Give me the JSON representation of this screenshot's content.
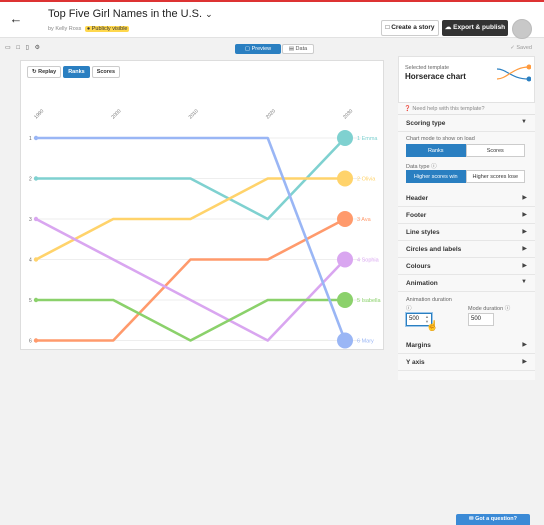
{
  "header": {
    "title": "Top Five Girl Names in the U.S.",
    "byline": "by Kelly Ross",
    "visibility_badge": "Publicly visible",
    "create_story_label": "Create a story",
    "export_label": "Export & publish"
  },
  "toolbar": {
    "preview_label": "Preview",
    "data_label": "Data",
    "saved_label": "Saved"
  },
  "preview": {
    "replay_label": "Replay",
    "ranks_label": "Ranks",
    "scores_label": "Scores"
  },
  "chart_data": {
    "type": "line",
    "chart_kind": "horserace",
    "x": [
      "1990",
      "2000",
      "2010",
      "2020",
      "2030"
    ],
    "ranks": [
      "1",
      "2",
      "3",
      "4",
      "5",
      "6"
    ],
    "series": [
      {
        "name": "Emma",
        "color": "#7fd1d0",
        "values": [
          2,
          2,
          2,
          3,
          1
        ],
        "end_rank": 1
      },
      {
        "name": "Olivia",
        "color": "#ffd36b",
        "values": [
          4,
          3,
          3,
          2,
          2
        ],
        "end_rank": 2
      },
      {
        "name": "Ava",
        "color": "#ff9a6c",
        "values": [
          6,
          6,
          4,
          4,
          3
        ],
        "end_rank": 3
      },
      {
        "name": "Sophia",
        "color": "#d9a6f0",
        "values": [
          3,
          4,
          5,
          6,
          4
        ],
        "end_rank": 4
      },
      {
        "name": "Isabella",
        "color": "#8bd16b",
        "values": [
          5,
          5,
          6,
          5,
          5
        ],
        "end_rank": 5
      },
      {
        "name": "Mary",
        "color": "#9ab6f5",
        "values": [
          1,
          1,
          1,
          1,
          6
        ],
        "end_rank": 6
      }
    ]
  },
  "sidebar": {
    "template_label": "Selected template",
    "template_name": "Horserace chart",
    "help_text": "Need help with this template?",
    "scoring": {
      "title": "Scoring type",
      "chart_mode_label": "Chart mode to show on load",
      "mode_options": [
        "Ranks",
        "Scores"
      ],
      "data_type_label": "Data type",
      "data_type_options": [
        "Higher scores win",
        "Higher scores lose"
      ]
    },
    "sections": [
      "Header",
      "Footer",
      "Line styles",
      "Circles and labels",
      "Colours"
    ],
    "animation": {
      "title": "Animation",
      "duration_label": "Animation duration",
      "duration_value": "500",
      "mode_duration_label": "Mode duration",
      "mode_duration_value": "500"
    },
    "bottom_sections": [
      "Margins",
      "Y axis"
    ]
  },
  "question_label": "Got a question?"
}
